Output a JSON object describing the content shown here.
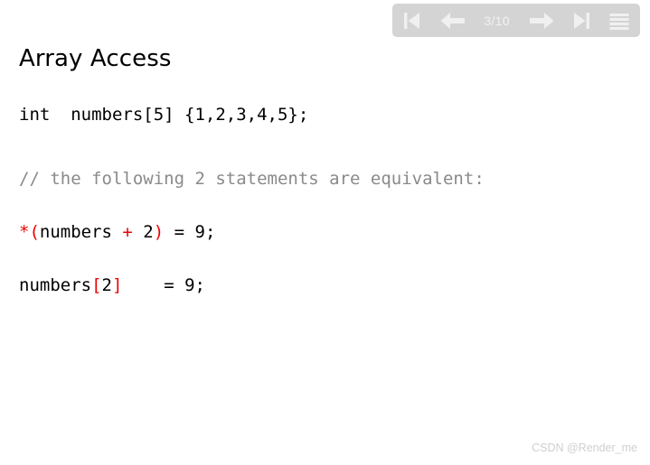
{
  "slide": {
    "title": "Array Access",
    "background_color": "#ffffff"
  },
  "toolbar": {
    "background_color": "#d4d4d4",
    "icon_color": "#f0f0f0",
    "counter": "3/10",
    "current_page": 3,
    "total_pages": 10,
    "buttons": [
      {
        "name": "first-slide",
        "icon": "skip-back-icon",
        "label": "First slide"
      },
      {
        "name": "previous-slide",
        "icon": "arrow-left-icon",
        "label": "Previous slide"
      },
      {
        "name": "next-slide",
        "icon": "arrow-right-icon",
        "label": "Next slide"
      },
      {
        "name": "last-slide",
        "icon": "skip-forward-icon",
        "label": "Last slide"
      },
      {
        "name": "menu",
        "icon": "hamburger-menu-icon",
        "label": "Menu"
      }
    ]
  },
  "code": {
    "declaration": {
      "t1": "int  numbers[5] {1,2,3,4,5};"
    },
    "comment": {
      "t1": "// the following 2 statements are equivalent:"
    },
    "pointer_form": {
      "t1": "*(",
      "t2": "numbers ",
      "t3": "+ ",
      "t4": "2",
      "t5": ")",
      "t6": " = 9;"
    },
    "index_form": {
      "t1": "numbers",
      "t2": "[",
      "t3": "2",
      "t4": "]",
      "t5": "    = 9;"
    }
  },
  "watermark": {
    "text": "CSDN @Render_me"
  }
}
